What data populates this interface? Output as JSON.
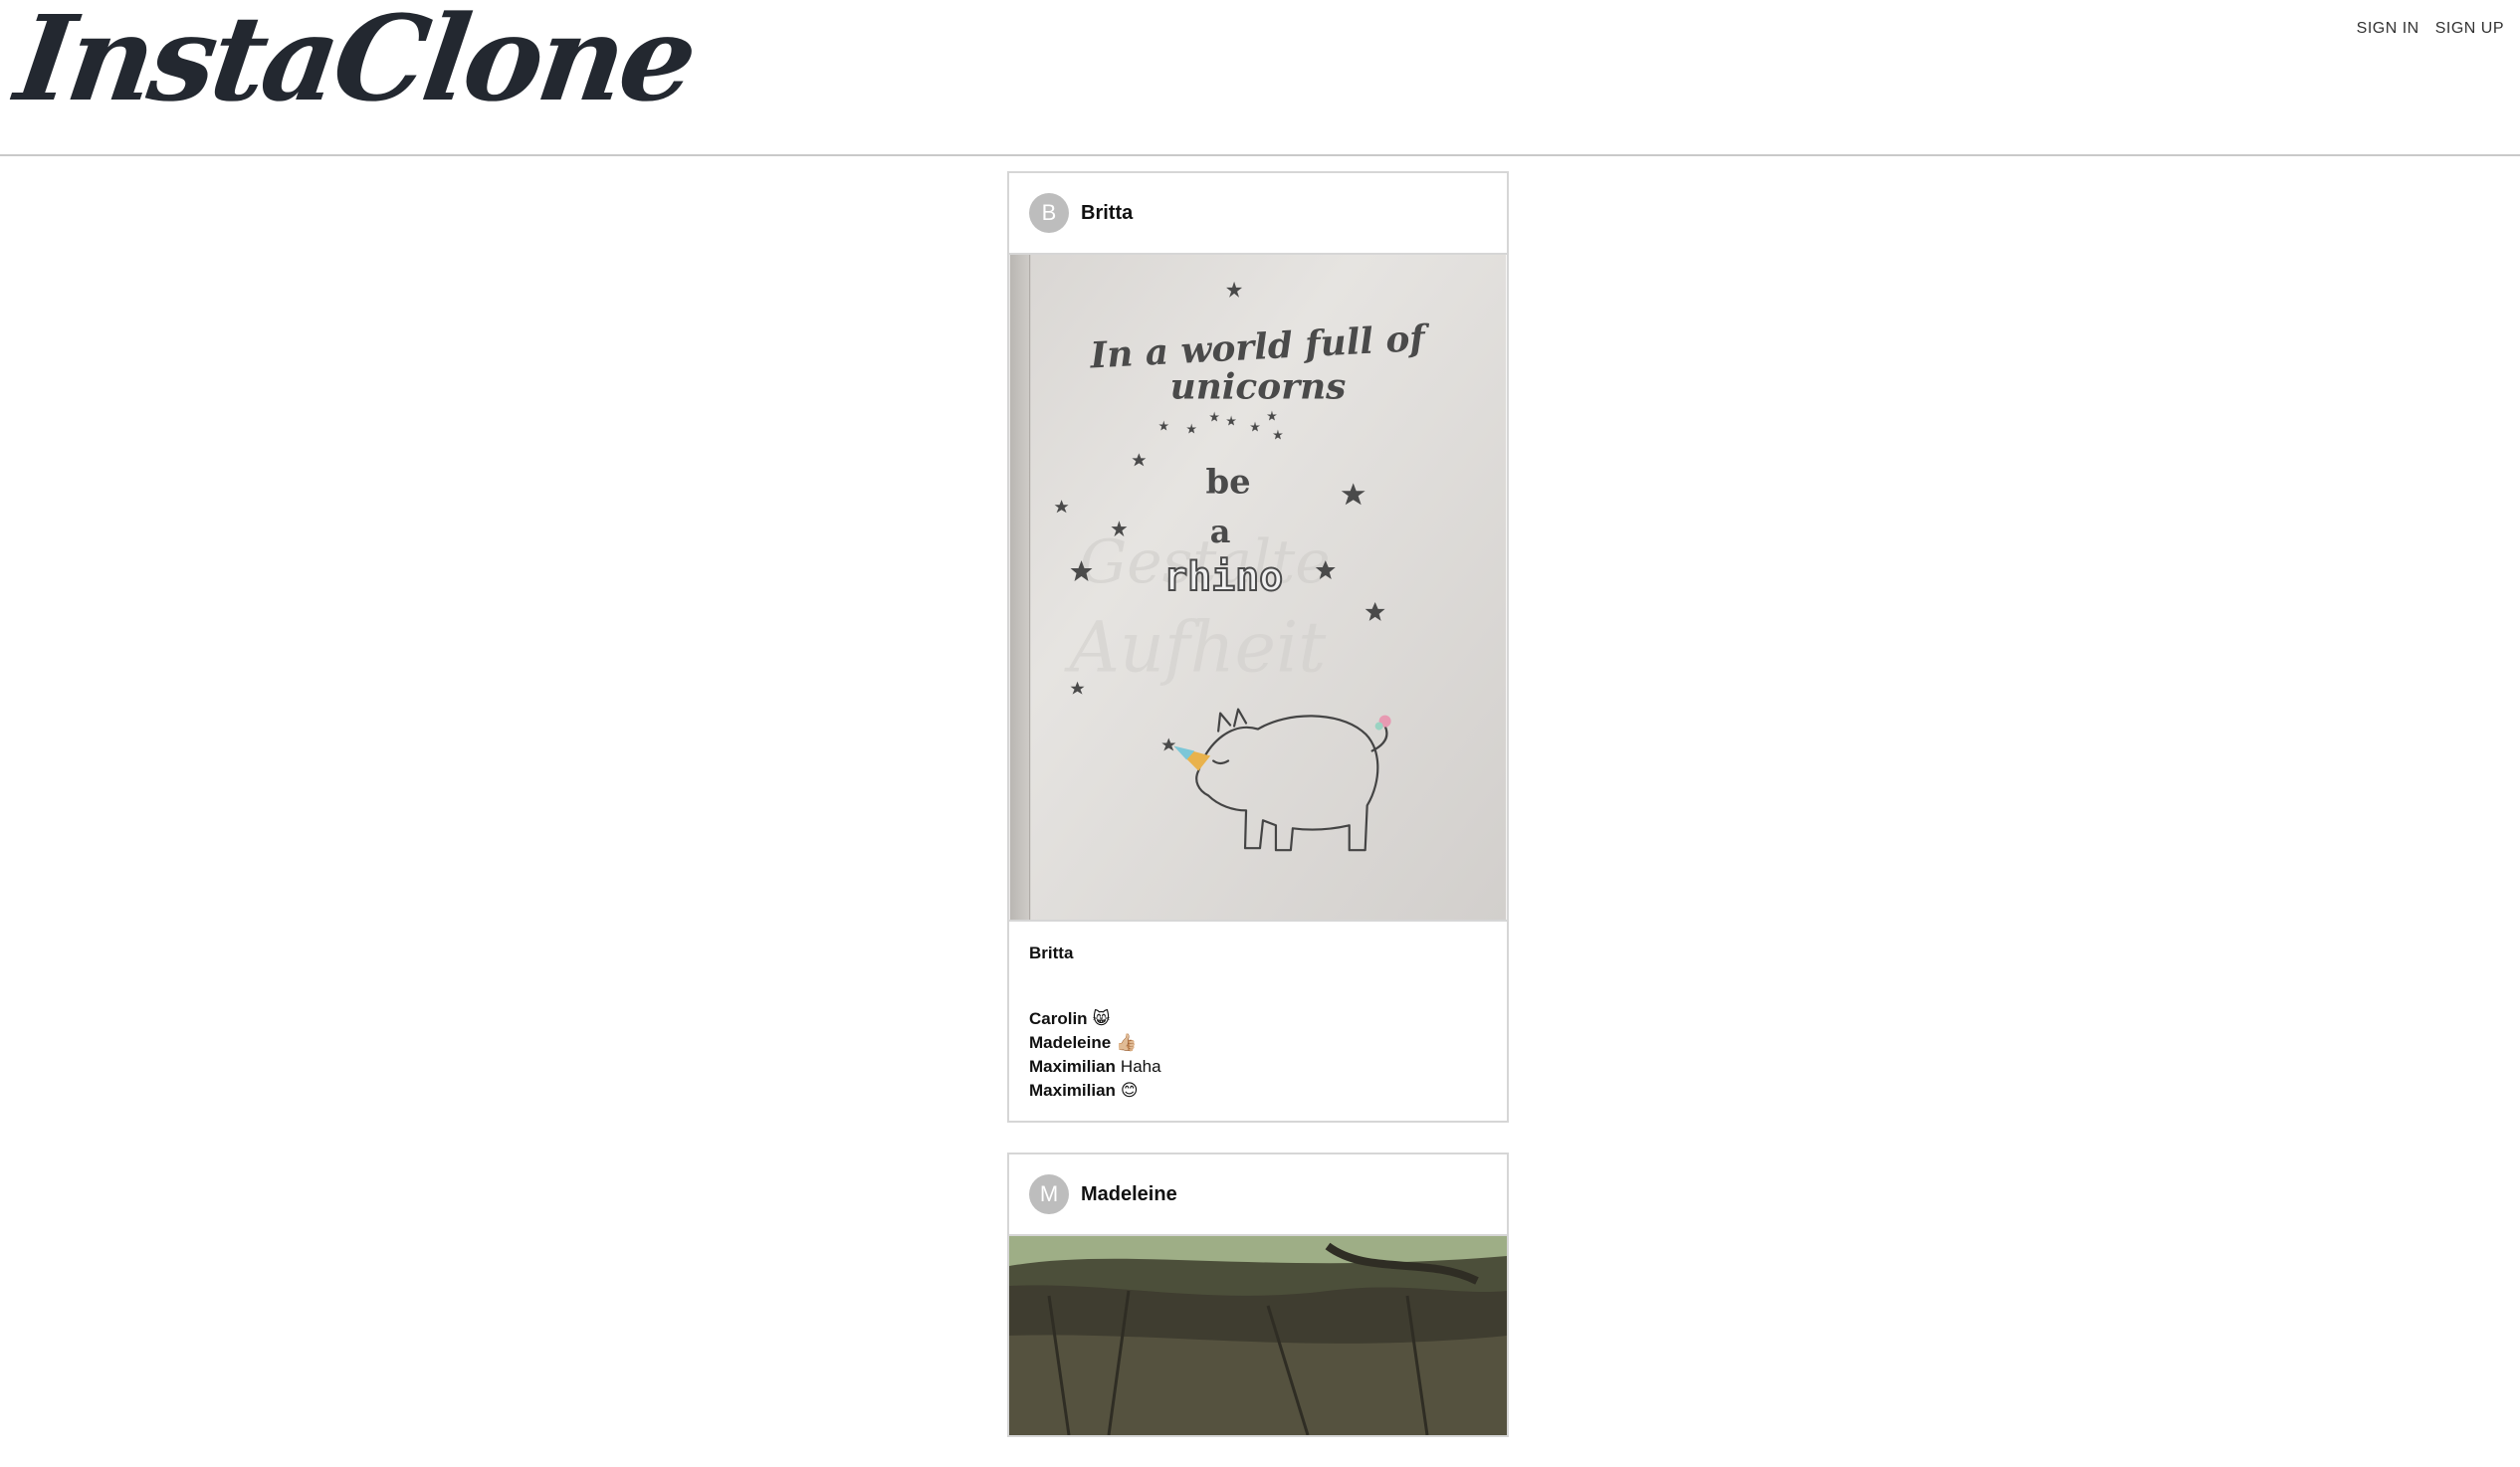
{
  "header": {
    "logo": "InstaClone",
    "nav": [
      {
        "label": "SIGN IN"
      },
      {
        "label": "SIGN UP"
      }
    ]
  },
  "posts": [
    {
      "avatar_initial": "B",
      "username": "Britta",
      "image_text": {
        "line1": "In a world full of",
        "line2": "unicorns",
        "line3": "be",
        "line4": "a",
        "line5": "rhino"
      },
      "caption_user": "Britta",
      "comments": [
        {
          "user": "Carolin",
          "text": "😸"
        },
        {
          "user": "Madeleine",
          "text": "👍🏼"
        },
        {
          "user": "Maximilian",
          "text": "Haha"
        },
        {
          "user": "Maximilian",
          "text": "😊"
        }
      ]
    },
    {
      "avatar_initial": "M",
      "username": "Madeleine"
    }
  ],
  "colors": {
    "logo": "#232830",
    "border": "#d6d6d6",
    "avatar_bg": "#bdbdbd"
  }
}
